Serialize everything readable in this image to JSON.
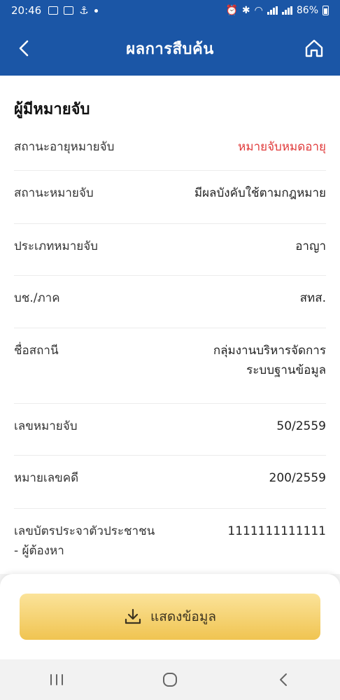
{
  "status_bar": {
    "time": "20:46",
    "battery": "86%"
  },
  "header": {
    "title": "ผลการสืบค้น"
  },
  "section": {
    "title": "ผู้มีหมายจับ"
  },
  "rows": [
    {
      "label": "สถานะอายุหมายจับ",
      "value": "หมายจับหมดอายุ"
    },
    {
      "label": "สถานะหมายจับ",
      "value": "มีผลบังคับใช้ตามกฎหมาย"
    },
    {
      "label": "ประเภทหมายจับ",
      "value": "อาญา"
    },
    {
      "label": "บช./ภาค",
      "value": "สทส."
    },
    {
      "label": "ชื่อสถานี",
      "value_line1": "กลุ่มงานบริหารจัดการ",
      "value_line2": "ระบบฐานข้อมูล"
    },
    {
      "label": "เลขหมายจับ",
      "value": "50/2559"
    },
    {
      "label": "หมายเลขคดี",
      "value": "200/2559"
    },
    {
      "label_line1": "เลขบัตรประจาตัวประชาชน",
      "label_line2": "- ผู้ต้องหา",
      "value": "1111111111111"
    }
  ],
  "action": {
    "show_label": "แสดงข้อมูล"
  },
  "colors": {
    "primary": "#1b56a6",
    "expired": "#e03a3a",
    "button": "#f0c451"
  }
}
